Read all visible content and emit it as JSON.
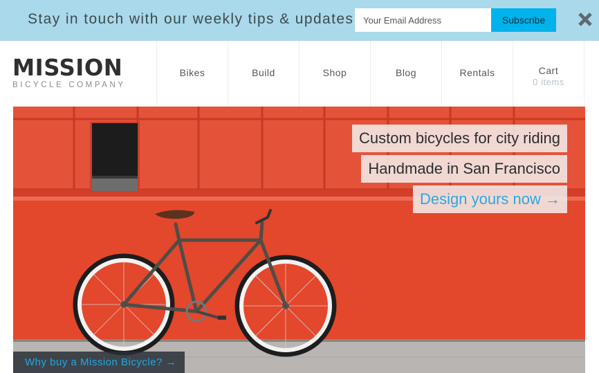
{
  "topbar": {
    "message": "Stay in touch with our weekly tips & updates:",
    "email_placeholder": "Your Email Address",
    "subscribe_label": "Subscribe",
    "close_icon": "close-icon"
  },
  "header": {
    "logo_main": "MISSION",
    "logo_sub": "BICYCLE COMPANY",
    "nav": {
      "bikes": "Bikes",
      "build": "Build",
      "shop": "Shop",
      "blog": "Blog",
      "rentals": "Rentals",
      "cart": "Cart",
      "cart_count": "0 items"
    }
  },
  "hero": {
    "tagline_1": "Custom bicycles for city riding",
    "tagline_2": "Handmade in San Francisco",
    "cta": "Design yours now →",
    "why_link": "Why buy a Mission Bicycle? →"
  },
  "colors": {
    "topbar_bg": "#a9d9ea",
    "subscribe_bg": "#00b3ec",
    "accent_link": "#2aa7e0",
    "wall_red": "#e0452d"
  }
}
